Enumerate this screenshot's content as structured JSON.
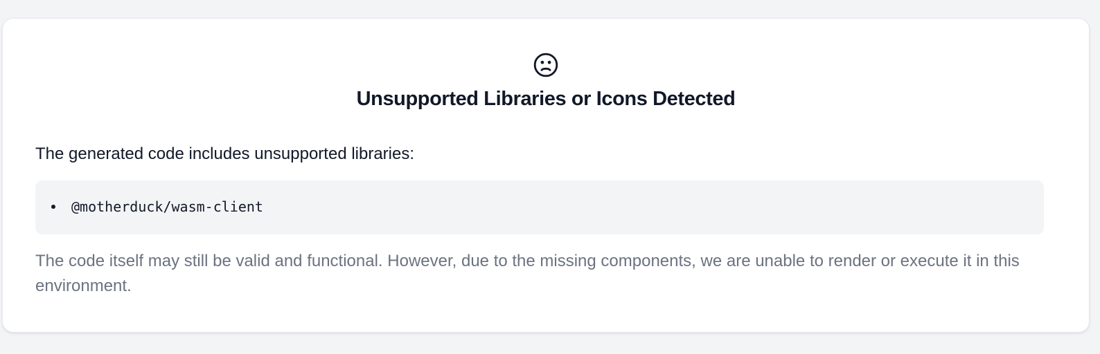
{
  "panel": {
    "icon": "sad-face-icon",
    "title": "Unsupported Libraries or Icons Detected",
    "intro": "The generated code includes unsupported libraries:",
    "libraries": [
      "@motherduck/wasm-client"
    ],
    "note": "The code itself may still be valid and functional. However, due to the missing components, we are unable to render or execute it in this environment."
  },
  "colors": {
    "background": "#f3f4f6",
    "card": "#ffffff",
    "title_text": "#111827",
    "muted_text": "#6b7280",
    "code_box": "#f3f4f6"
  }
}
